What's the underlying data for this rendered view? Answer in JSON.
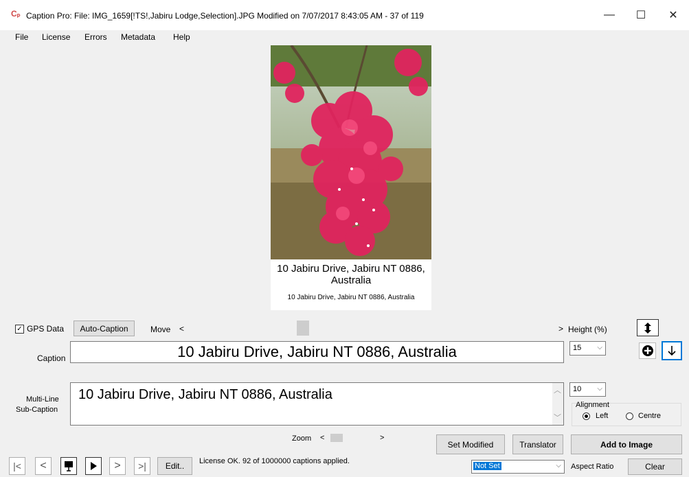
{
  "window": {
    "title": "Caption Pro: File: IMG_1659[!TS!,Jabiru Lodge,Selection].JPG Modified on 7/07/2017 8:43:05 AM - 37 of 119",
    "app_icon": "Cₚ",
    "minimize": "—",
    "maximize": "☐",
    "close": "✕"
  },
  "menu": [
    "File",
    "License",
    "Errors",
    "Metadata",
    "Help"
  ],
  "preview": {
    "caption_text": "10 Jabiru Drive, Jabiru NT 0886, Australia",
    "subcaption_text": "10 Jabiru Drive, Jabiru NT 0886, Australia"
  },
  "controls": {
    "gps_label": "GPS Data",
    "gps_checked": true,
    "gps_check_mark": "✓",
    "auto_caption": "Auto-Caption",
    "move_label": "Move",
    "move_left": "<",
    "move_right": ">",
    "height_label": "Height (%)",
    "caption_label": "Caption",
    "caption_value": "10 Jabiru Drive, Jabiru NT 0886, Australia",
    "caption_height": "15",
    "multiline_label_1": "Multi-Line",
    "multiline_label_2": "Sub-Caption",
    "subcaption_value": "10 Jabiru Drive, Jabiru NT 0886, Australia",
    "subcaption_size": "10",
    "alignment_label": "Alignment",
    "align_left": "Left",
    "align_centre": "Centre",
    "align_selected": "Left",
    "zoom_label": "Zoom",
    "zoom_left": "<",
    "zoom_right": ">",
    "set_modified": "Set Modified",
    "translator": "Translator",
    "add_to_image": "Add to Image",
    "edit": "Edit..",
    "status": "License OK. 92 of 1000000 captions applied.",
    "aspect_select": "Not Set",
    "aspect_label": "Aspect Ratio",
    "clear": "Clear",
    "dropdown_arrow": "⌵",
    "scroll_up": "︿",
    "scroll_down": "﹀"
  },
  "nav": {
    "first": "|<",
    "prev": "<",
    "slideshow": "▀",
    "play": "▶",
    "next": ">",
    "last": ">|"
  },
  "icons": {
    "height_toggle": "up-down-arrow-icon",
    "plus": "plus-circle-icon",
    "down": "down-arrow-icon"
  },
  "colors": {
    "accent_border": "#0078d7",
    "select_highlight": "#0078d7",
    "flower": "#e0245e"
  }
}
